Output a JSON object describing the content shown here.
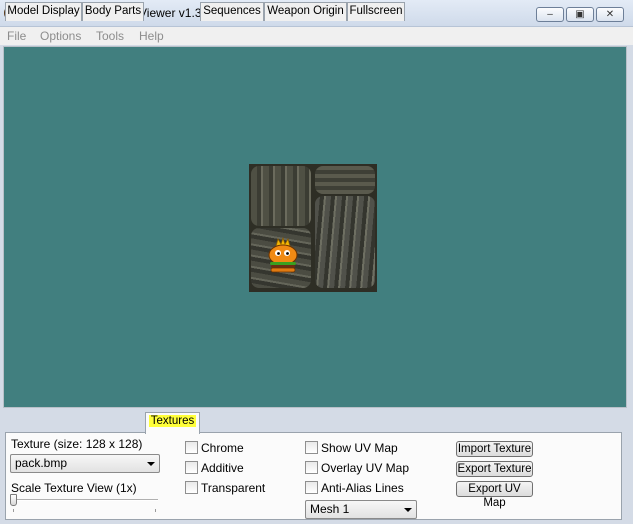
{
  "window": {
    "title": "Jed's Half-Life Model Viewer v1.36",
    "controls": [
      "minimize-icon",
      "maximize-icon",
      "close-icon"
    ]
  },
  "menu": [
    "File",
    "Options",
    "Tools",
    "Help"
  ],
  "viewport": {
    "background": "#417f7f",
    "texture_image": "pack.bmp"
  },
  "tabs": [
    {
      "label": "Model Display",
      "active": false
    },
    {
      "label": "Body Parts",
      "active": false
    },
    {
      "label": "Textures",
      "active": true
    },
    {
      "label": "Sequences",
      "active": false
    },
    {
      "label": "Weapon Origin",
      "active": false
    },
    {
      "label": "Fullscreen",
      "active": false
    }
  ],
  "textures_panel": {
    "texture_label": "Texture (size: 128 x 128)",
    "texture_select": "pack.bmp",
    "scale_label": "Scale Texture View (1x)",
    "scale_level": 0,
    "checkboxes_left": [
      {
        "label": "Chrome",
        "checked": false
      },
      {
        "label": "Additive",
        "checked": false
      },
      {
        "label": "Transparent",
        "checked": false
      }
    ],
    "checkboxes_right": [
      {
        "label": "Show UV Map",
        "checked": false
      },
      {
        "label": "Overlay UV Map",
        "checked": false
      },
      {
        "label": "Anti-Alias Lines",
        "checked": false
      }
    ],
    "mesh_select": "Mesh 1",
    "buttons": [
      "Import Texture",
      "Export Texture",
      "Export UV Map"
    ]
  },
  "colors": {
    "highlight": "#ffff3a",
    "viewport_bg": "#417f7f"
  }
}
